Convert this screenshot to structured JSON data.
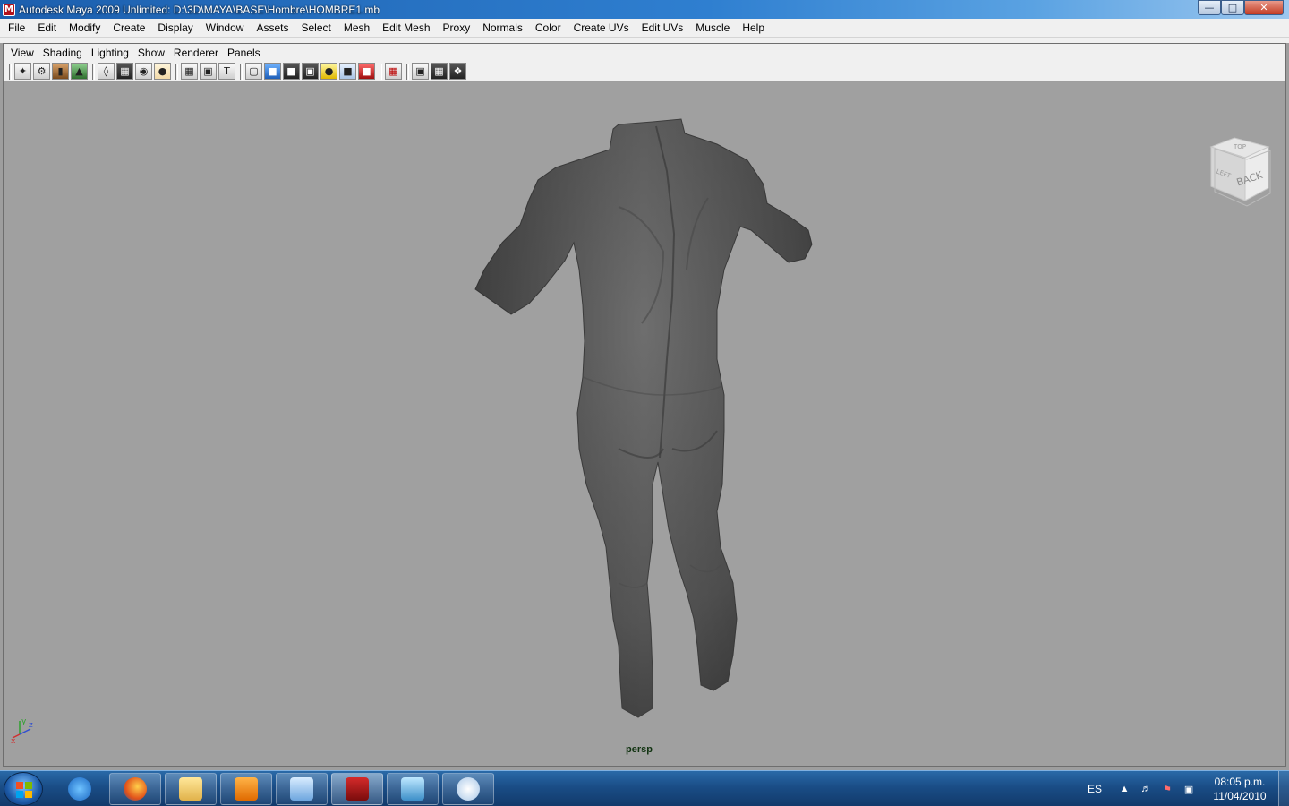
{
  "window": {
    "title": "Autodesk Maya 2009 Unlimited: D:\\3D\\MAYA\\BASE\\Hombre\\HOMBRE1.mb",
    "controls": [
      "minimize",
      "maximize",
      "close"
    ]
  },
  "menubar": {
    "items": [
      "File",
      "Edit",
      "Modify",
      "Create",
      "Display",
      "Window",
      "Assets",
      "Select",
      "Mesh",
      "Edit Mesh",
      "Proxy",
      "Normals",
      "Color",
      "Create UVs",
      "Edit UVs",
      "Muscle",
      "Help"
    ]
  },
  "panel": {
    "menu": [
      "View",
      "Shading",
      "Lighting",
      "Show",
      "Renderer",
      "Panels"
    ],
    "toolbar_icons": [
      "select-camera-icon",
      "lock-camera-icon",
      "bookmark-icon",
      "image-plane-icon",
      "two-d-pan-icon",
      "grid-icon",
      "film-gate-icon",
      "resolution-gate-icon",
      "gate-mask-icon",
      "field-chart-icon",
      "safe-action-icon",
      "safe-title-icon",
      "wireframe-icon",
      "smooth-shade-icon",
      "wireframe-on-shaded-icon",
      "textured-icon",
      "use-all-lights-icon",
      "shadows-icon",
      "xray-icon",
      "isolate-select-icon",
      "xray-joints-icon",
      "hardware-texturing-icon",
      "high-quality-icon"
    ],
    "viewcube_label": "BACK",
    "viewcube_top": "TOP",
    "viewcube_side": "LEFT",
    "camera_label": "persp",
    "axis": {
      "x": "x",
      "y": "y",
      "z": "z"
    }
  },
  "taskbar": {
    "apps": [
      "internet-explorer-icon",
      "firefox-icon",
      "explorer-icon",
      "media-player-icon",
      "tools-icon",
      "maya-icon",
      "notepad-icon",
      "paint-icon"
    ],
    "active_app": "maya-icon",
    "language": "ES",
    "time": "08:05 p.m.",
    "date": "11/04/2010"
  }
}
